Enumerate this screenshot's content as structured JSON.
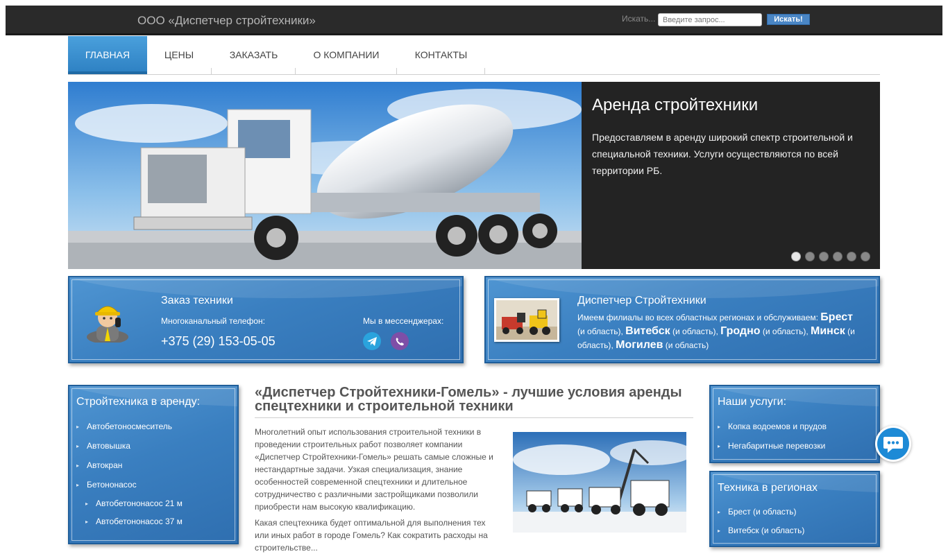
{
  "header": {
    "site_name": "ООО «Диспетчер стройтехники»",
    "search_label": "Искать...",
    "search_placeholder": "Введите запрос...",
    "search_button": "Искать!"
  },
  "nav": {
    "items": [
      {
        "label": "ГЛАВНАЯ",
        "active": true
      },
      {
        "label": "ЦЕНЫ",
        "active": false
      },
      {
        "label": "ЗАКАЗАТЬ",
        "active": false
      },
      {
        "label": "О КОМПАНИИ",
        "active": false
      },
      {
        "label": "КОНТАКТЫ",
        "active": false
      }
    ]
  },
  "slider": {
    "title": "Аренда стройтехники",
    "text": "Предоставляем в аренду широкий спектр строительной и специальной техники. Услуги осуществляются по всей территории РБ.",
    "slides_count": 6,
    "active_slide": 1
  },
  "order_panel": {
    "title": "Заказ техники",
    "phone_label": "Многоканальный телефон:",
    "phone": "+375 (29) 153-05-05",
    "messengers_label": "Мы в мессенджерах:",
    "messenger_icons": [
      "telegram-icon",
      "viber-icon"
    ]
  },
  "dispatcher_panel": {
    "title": "Диспетчер Стройтехники",
    "intro": "Имеем филиалы во всех областных регионах и обслуживаем:",
    "cities": [
      "Брест",
      "Витебск",
      "Гродно",
      "Минск",
      "Могилев"
    ],
    "region_suffix": "(и область)"
  },
  "rental_sidebar": {
    "title": "Стройтехника в аренду:",
    "items": [
      "Автобетоносмеситель",
      "Автовышка",
      "Автокран",
      "Бетононасос"
    ],
    "subitems": [
      "Автобетононасос 21 м",
      "Автобетононасос 37 м"
    ]
  },
  "article": {
    "title": "«Диспетчер Стройтехники-Гомель» - лучшие условия аренды спецтехники и строительной техники",
    "paragraph_1": "Многолетний опыт использования строительной техники в проведении строительных работ позволяет компании «Диспетчер Стройтехники-Гомель» решать самые сложные и нестандартные задачи. Узкая специализация, знание особенностей современной спецтехники и длительное сотрудничество с различными застройщиками позволили приобрести нам высокую квалификацию.",
    "paragraph_2": "Какая спецтехника будет оптимальной для выполнения тех или иных работ в городе Гомель? Как сократить расходы на строительстве..."
  },
  "services_sidebar": {
    "title": "Наши услуги:",
    "items": [
      "Копка водоемов и прудов",
      "Негабаритные перевозки"
    ]
  },
  "regions_sidebar": {
    "title": "Техника в регионах",
    "items": [
      "Брест (и область)",
      "Витебск (и область)"
    ]
  },
  "colors": {
    "topbar": "#2a2a2a",
    "nav_active": "#2f82c4",
    "panel_blue": "#3a7fc0",
    "search_button": "#4a86c5",
    "chat_button": "#1d8ad6"
  }
}
